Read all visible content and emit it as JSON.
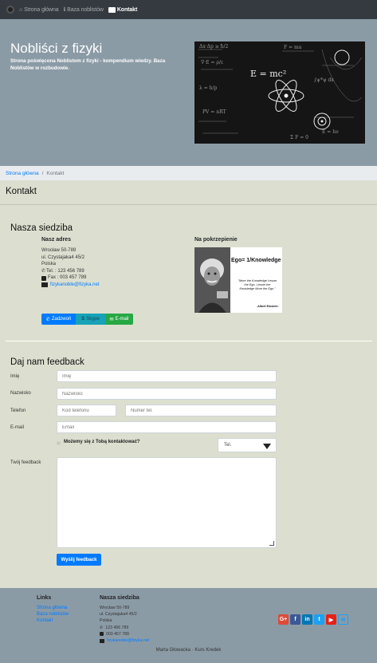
{
  "nav": {
    "items": [
      {
        "label": "Strona główna"
      },
      {
        "label": "Baza noblistów"
      },
      {
        "label": "Kontakt"
      }
    ]
  },
  "hero": {
    "title": "Nobliści z fizyki",
    "subtitle": "Strona poświęcona Noblistom z fizyki - kompendium wiedzy. Baza Noblistów w rozbudowie."
  },
  "breadcrumb": {
    "home": "Strona główna",
    "separator": "/",
    "current": "Kontakt"
  },
  "page_title": "Kontakt",
  "seat": {
    "title": "Nasza siedziba",
    "address_title": "Nasz adres",
    "lines": [
      "Wrocław 50-789",
      "ul. Czystajaka4 45/2",
      "Polska"
    ],
    "tel": "Tel. : 123 456 789",
    "fax": "Fax : 003 457 789",
    "email": "fizykanoble@fizyka.net",
    "inspire_title": "Na pokrzepienie",
    "einstein_quote_title": "Ego= 1/Knowledge",
    "einstein_quote": "\"More the Knowledge Lesser the Ego, Lesser the Knowledge More the Ego.\"",
    "einstein_author": "-Albert Einstein.",
    "buttons": {
      "call": "Zadzwoń",
      "skype": "Skype",
      "email": "E-mail"
    }
  },
  "feedback": {
    "title": "Daj nam feedback",
    "labels": {
      "name": "Imię",
      "surname": "Nazwisko",
      "phone": "Telefon",
      "email": "E-mail",
      "feedback": "Twój feedback"
    },
    "placeholders": {
      "name": "Imię",
      "surname": "Nazwisko",
      "phone_code": "Kod telefonu",
      "phone_number": "Numer tel.",
      "email": "Email"
    },
    "contact_question": "Możemy się z Tobą kontaktować?",
    "contact_select": "Tel.",
    "submit": "Wyślij feedback"
  },
  "footer": {
    "links_title": "Links",
    "links": [
      "Strona główna",
      "Baza noblistów",
      "Kontakt"
    ],
    "address_title": "Nasza siedziba",
    "address_lines": [
      "Wrocław 50-789",
      "ul. Czystajaka4 45/2",
      "Polska"
    ],
    "tel": "123 456 789",
    "fax": "003 457 789",
    "email": "fizykanoble@fizyka.net",
    "socials": [
      "google-plus-icon",
      "facebook-icon",
      "linkedin-icon",
      "twitter-icon",
      "youtube-icon",
      "mail-icon"
    ],
    "credits": "Marta Głowacka · Kurs Kredek"
  },
  "colors": {
    "navbar": "#343a40",
    "hero": "#8b9ba6",
    "page": "#dcdfcf",
    "primary": "#007bff",
    "info": "#17a2b8",
    "success": "#28a745"
  }
}
